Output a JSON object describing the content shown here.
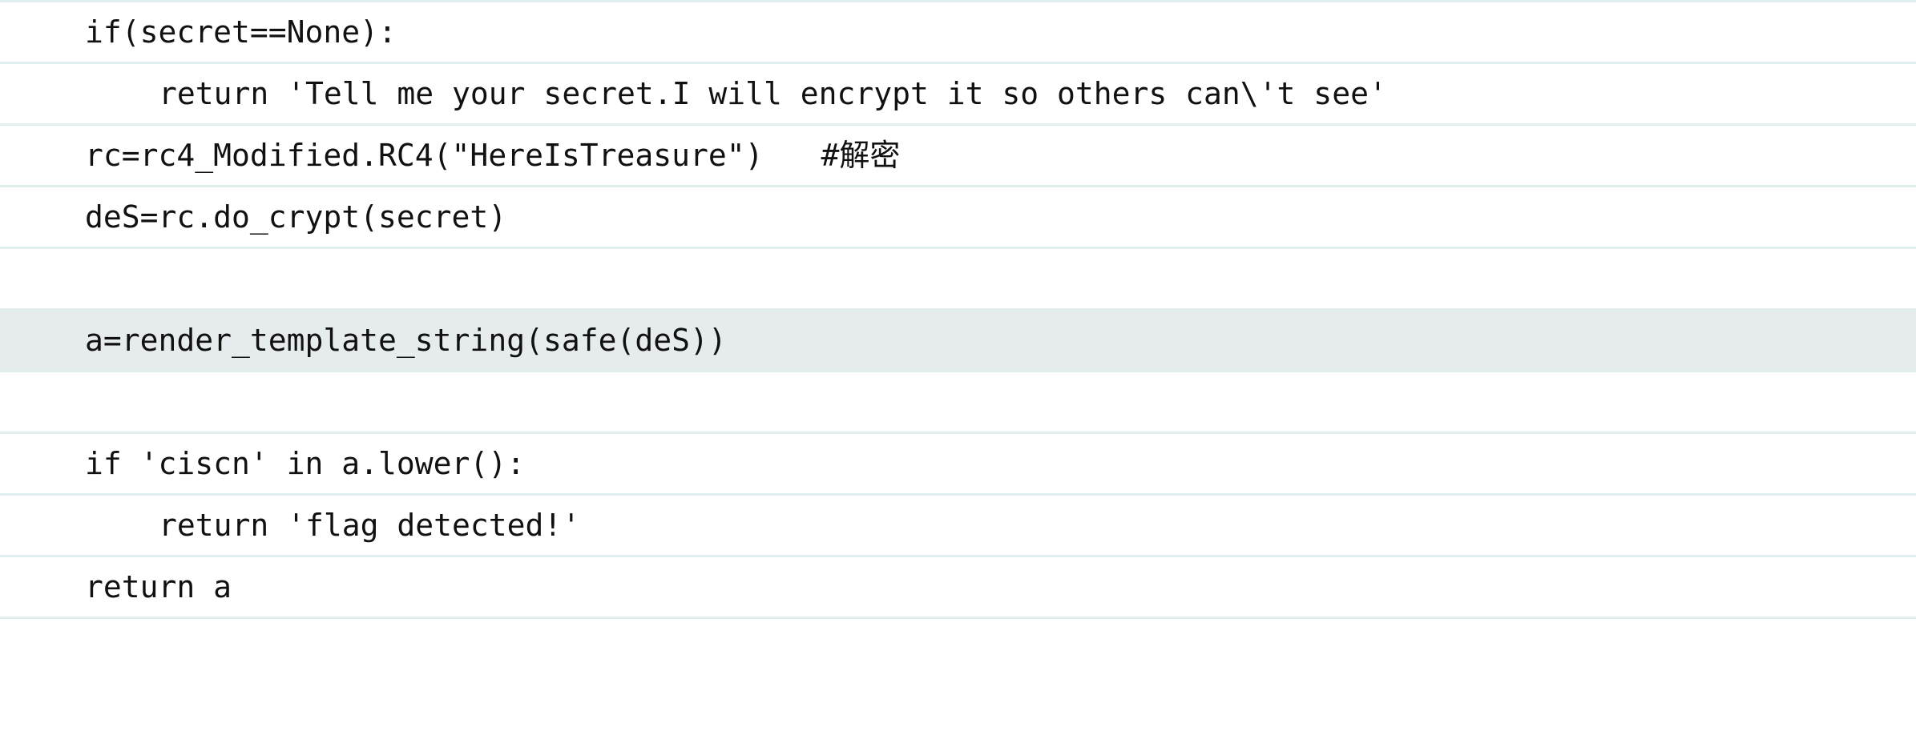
{
  "code_viewer": {
    "lines": [
      {
        "text": "if(secret==None):",
        "indent": 0,
        "highlighted": false
      },
      {
        "text": "return 'Tell me your secret.I will encrypt it so others can\\'t see'",
        "indent": 1,
        "highlighted": false
      },
      {
        "text": "rc=rc4_Modified.RC4(\"HereIsTreasure\")",
        "comment": "#解密",
        "indent": 0,
        "highlighted": false
      },
      {
        "text": "deS=rc.do_crypt(secret)",
        "indent": 0,
        "highlighted": false
      },
      {
        "text": "",
        "indent": 0,
        "highlighted": false
      },
      {
        "text": "a=render_template_string(safe(deS))",
        "indent": 0,
        "highlighted": true
      },
      {
        "text": "",
        "indent": 0,
        "highlighted": false
      },
      {
        "text": "if 'ciscn' in a.lower():",
        "indent": 0,
        "highlighted": false
      },
      {
        "text": "return 'flag detected!'",
        "indent": 1,
        "highlighted": false
      },
      {
        "text": "return a",
        "indent": 0,
        "highlighted": false
      }
    ],
    "colors": {
      "line_border": "#e0eeee",
      "highlight_background": "#e6eced",
      "text": "#111111"
    }
  }
}
